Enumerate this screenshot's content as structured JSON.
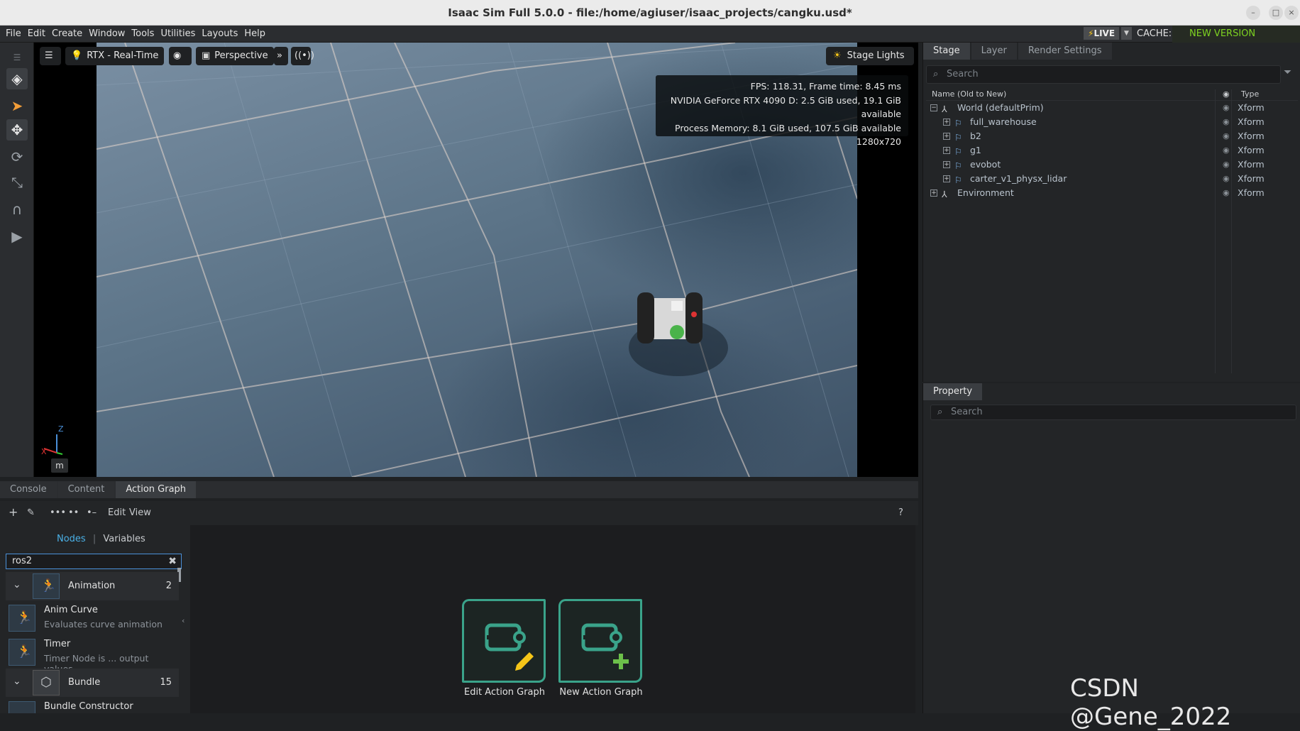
{
  "window": {
    "title": "Isaac Sim Full 5.0.0 - file:/home/agiuser/isaac_projects/cangku.usd*"
  },
  "menu": {
    "items": [
      "File",
      "Edit",
      "Create",
      "Window",
      "Tools",
      "Utilities",
      "Layouts",
      "Help"
    ]
  },
  "status": {
    "live": "LIVE",
    "cache": "CACHE:",
    "new_version": "NEW VERSION DETECTED"
  },
  "viewport": {
    "renderer": "RTX - Real-Time",
    "camera": "Perspective",
    "stage_lights": "Stage Lights",
    "stats": {
      "fps": "FPS: 118.31, Frame time: 8.45 ms",
      "gpu": "NVIDIA GeForce RTX 4090 D: 2.5 GiB used, 19.1 GiB available",
      "process": "Process Memory: 8.1 GiB used, 107.5 GiB available",
      "resolution": "1280x720"
    },
    "axis": {
      "z": "Z",
      "x": "X"
    },
    "units": "m"
  },
  "stage": {
    "tabs": [
      "Stage",
      "Layer",
      "Render Settings"
    ],
    "search_placeholder": "Search",
    "header": {
      "name": "Name (Old to New)",
      "type": "Type"
    },
    "rows": [
      {
        "name": "World (defaultPrim)",
        "type": "Xform"
      },
      {
        "name": "full_warehouse",
        "type": "Xform"
      },
      {
        "name": "b2",
        "type": "Xform"
      },
      {
        "name": "g1",
        "type": "Xform"
      },
      {
        "name": "evobot",
        "type": "Xform"
      },
      {
        "name": "carter_v1_physx_lidar",
        "type": "Xform"
      },
      {
        "name": "Environment",
        "type": "Xform"
      }
    ]
  },
  "property": {
    "tab": "Property",
    "search_placeholder": "Search"
  },
  "bottom": {
    "tabs": [
      "Console",
      "Content",
      "Action Graph"
    ],
    "toolbar": {
      "edit": "Edit",
      "view": "View",
      "help": "?"
    },
    "sidebar": {
      "nodes_tab": "Nodes",
      "sep": "|",
      "variables_tab": "Variables",
      "search_value": "ros2",
      "categories": [
        {
          "label": "Animation",
          "count": "2"
        },
        {
          "label": "Bundle",
          "count": "15"
        }
      ],
      "nodes": [
        {
          "title": "Anim Curve",
          "desc": "Evaluates curve animation"
        },
        {
          "title": "Timer",
          "desc": "Timer Node is ... output values."
        },
        {
          "title": "Bundle Constructor",
          "desc": ""
        }
      ]
    },
    "canvas": {
      "edit_graph": "Edit Action Graph",
      "new_graph": "New Action Graph"
    }
  },
  "watermark": "CSDN @Gene_2022"
}
